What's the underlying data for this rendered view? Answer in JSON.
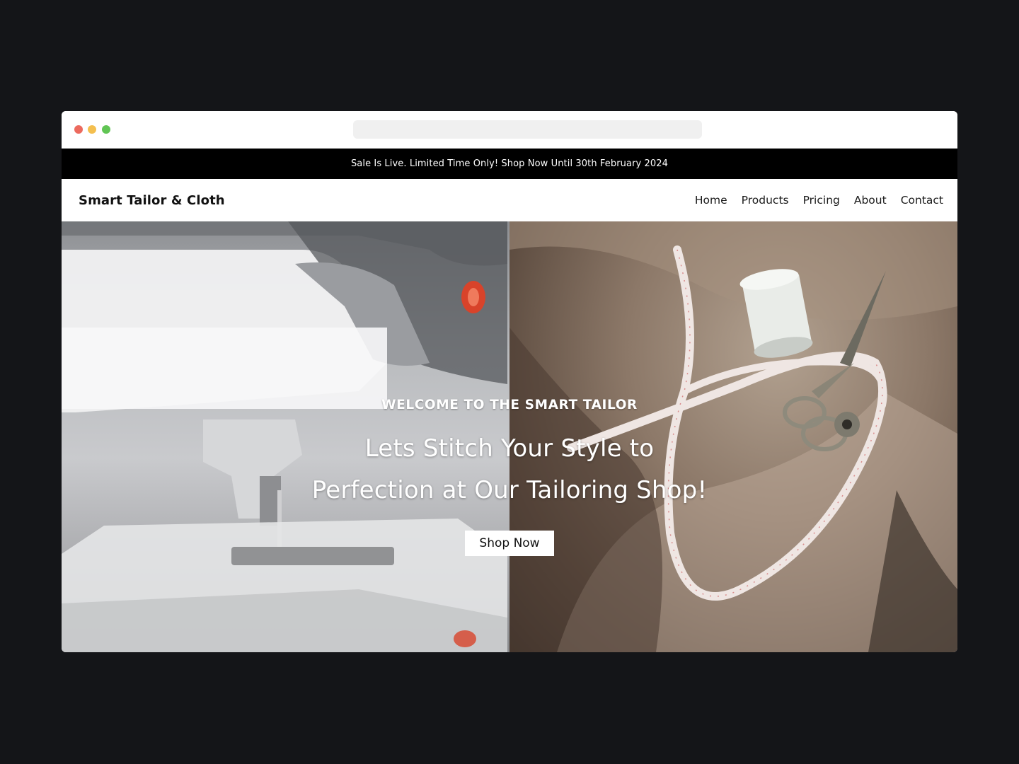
{
  "window": {
    "colors": {
      "close": "#ec6a5e",
      "minimize": "#f4bf4f",
      "zoom": "#61c554"
    }
  },
  "announcement": {
    "text": "Sale Is Live. Limited Time Only! Shop Now Until 30th February 2024"
  },
  "navbar": {
    "brand": "Smart Tailor & Cloth",
    "links": [
      "Home",
      "Products",
      "Pricing",
      "About",
      "Contact"
    ]
  },
  "hero": {
    "eyebrow": "WELCOME TO THE SMART TAILOR",
    "headline_line1": "Lets Stitch Your Style to",
    "headline_line2": "Perfection at Our Tailoring Shop!",
    "cta_label": "Shop Now"
  }
}
